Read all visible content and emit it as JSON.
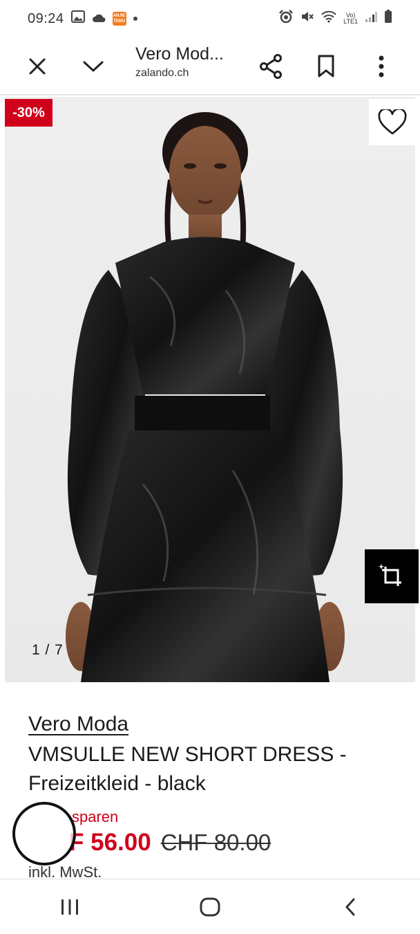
{
  "status_bar": {
    "time": "09:24",
    "icons": [
      "image-icon",
      "cloud-icon",
      "temu-app-icon",
      "notification-dot-icon",
      "alarm-icon",
      "mute-icon",
      "wifi-icon",
      "volte-lte-icon",
      "signal-icon",
      "battery-icon"
    ],
    "temu_label": "ANJIE TEMU",
    "lte_label_top": "Vo)",
    "lte_label_bottom": "LTE1"
  },
  "browser": {
    "title": "Vero Mod...",
    "domain": "zalando.ch",
    "close_icon": "close-icon",
    "collapse_icon": "chevron-down-icon",
    "share_icon": "share-icon",
    "bookmark_icon": "bookmark-icon",
    "menu_icon": "more-vert-icon"
  },
  "gallery": {
    "discount": "-30%",
    "counter": "1 / 7",
    "wishlist_icon": "heart-icon",
    "crop_icon": "crop-search-icon"
  },
  "product": {
    "brand": "Vero Moda",
    "name": "VMSULLE NEW SHORT DRESS - Freizeitkleid - black",
    "savings": "sparen",
    "price_now": "F 56.00",
    "price_old": "CHF 80.00",
    "vat": "inkl. MwSt."
  },
  "nav": {
    "recents_icon": "recents-icon",
    "home_icon": "home-icon",
    "back_icon": "back-icon"
  },
  "colors": {
    "sale_red": "#d0021b",
    "text": "#1a1a1a",
    "image_bg": "#ececec"
  }
}
